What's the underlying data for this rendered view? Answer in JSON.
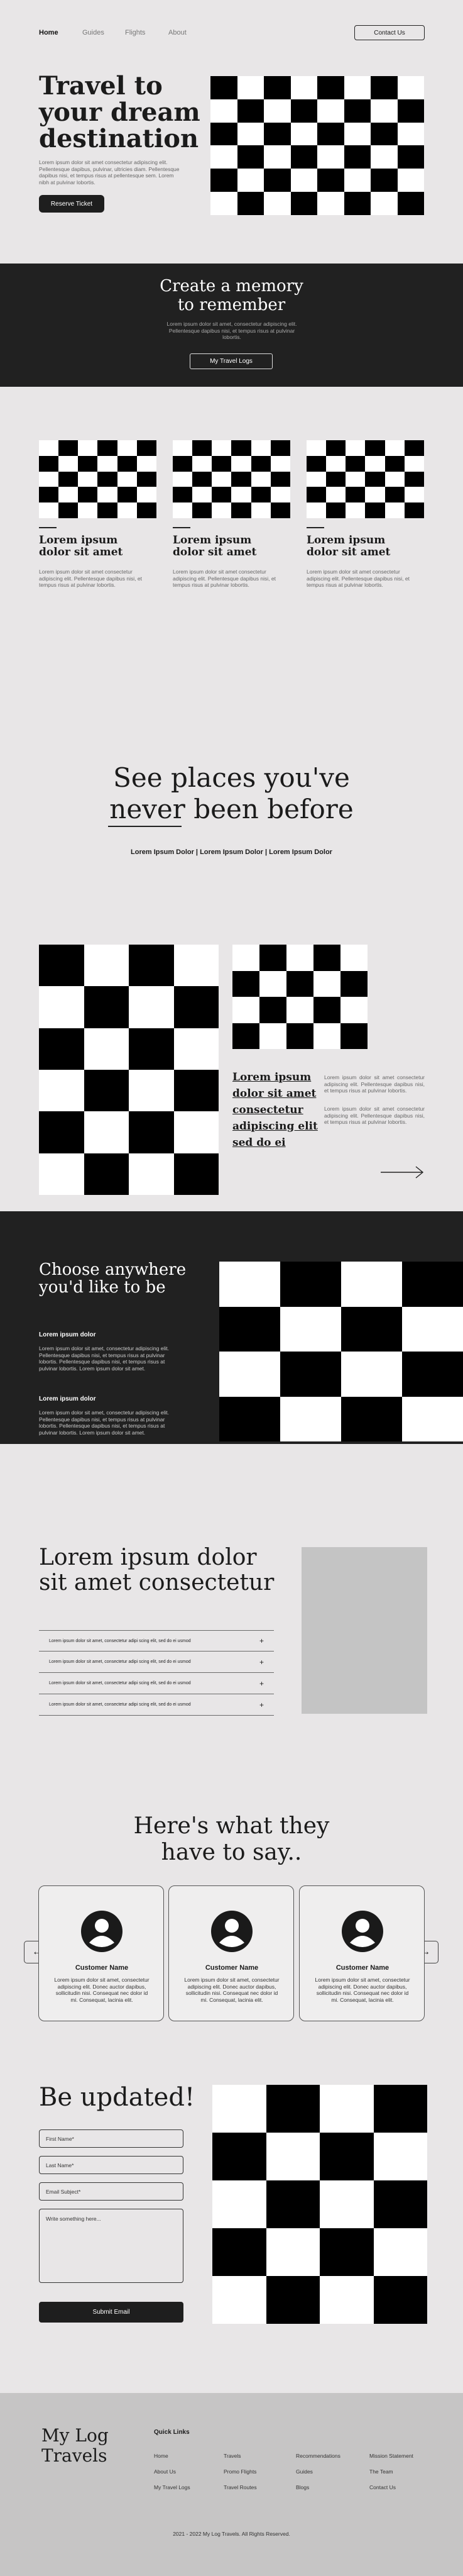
{
  "nav": {
    "home": "Home",
    "guides": "Guides",
    "flights": "Flights",
    "about": "About",
    "contact": "Contact Us"
  },
  "hero": {
    "title_lines": [
      "Travel to",
      "your dream",
      "destination"
    ],
    "body": "Lorem ipsum dolor sit amet consectetur adipiscing elit. Pellentesque dapibus, pulvinar, ultricies diam. Pellentesque dapibus nisi, et tempus risus at pellentesque sem. Lorem nibh at pulvinar lobortis.",
    "button": "Reserve Ticket"
  },
  "memory": {
    "title_lines": [
      "Create a memory",
      "to remember"
    ],
    "body": "Lorem ipsum dolor sit amet, consectetur adipiscing elit. Pellentesque dapibus nisi, et tempus risus at pulvinar lobortis.",
    "button": "My Travel Logs"
  },
  "feature_cards": [
    {
      "title_lines": [
        "Lorem ipsum",
        "dolor sit amet"
      ],
      "body": "Lorem ipsum dolor sit amet consectetur adipiscing elit. Pellentesque dapibus nisi, et tempus risus at pulvinar lobortis."
    },
    {
      "title_lines": [
        "Lorem ipsum",
        "dolor sit amet"
      ],
      "body": "Lorem ipsum dolor sit amet consectetur adipiscing elit. Pellentesque dapibus nisi, et tempus risus at pulvinar lobortis."
    },
    {
      "title_lines": [
        "Lorem ipsum",
        "dolor sit amet"
      ],
      "body": "Lorem ipsum dolor sit amet consectetur adipiscing elit. Pellentesque dapibus nisi, et tempus risus at pulvinar lobortis."
    }
  ],
  "places": {
    "title_lines": [
      "See places you've",
      "never been before"
    ],
    "tags": "Lorem Ipsum Dolor | Lorem Ipsum Dolor | Lorem Ipsum Dolor"
  },
  "gallery": {
    "caption_lines": [
      "Lorem ipsum",
      "dolor sit amet",
      "consectetur",
      "adipiscing elit",
      "sed do ei"
    ],
    "para1": "Lorem ipsum dolor sit amet consectetur adipiscing elit. Pellentesque dapibus nisi, et tempus risus at pulvinar lobortis.",
    "para2": "Lorem ipsum dolor sit amet consectetur adipiscing elit. Pellentesque dapibus nisi, et tempus risus at pulvinar lobortis."
  },
  "choose": {
    "title_lines": [
      "Choose anywhere",
      "you'd like to be"
    ],
    "h1": "Lorem ipsum dolor",
    "p1": "Lorem ipsum dolor sit amet, consectetur adipiscing elit. Pellentesque dapibus nisi, et tempus risus at pulvinar lobortis. Pellentesque dapibus nisi, et tempus risus at pulvinar lobortis. Lorem ipsum dolor sit amet.",
    "h2": "Lorem ipsum dolor",
    "p2": "Lorem ipsum dolor sit amet, consectetur adipiscing elit. Pellentesque dapibus nisi, et tempus risus at pulvinar lobortis. Pellentesque dapibus nisi, et tempus risus at pulvinar lobortis. Lorem ipsum dolor sit amet."
  },
  "faq": {
    "title_lines": [
      "Lorem ipsum dolor",
      "sit amet consectetur"
    ],
    "items": [
      "Lorem ipsum dolor sit amet, consectetur adipi scing elit, sed do ei usmod",
      "Lorem ipsum dolor sit amet, consectetur adipi scing elit, sed do ei usmod",
      "Lorem ipsum dolor sit amet, consectetur adipi scing elit, sed do ei usmod",
      "Lorem ipsum dolor sit amet, consectetur adipi scing elit, sed do ei usmod"
    ],
    "plus": "+"
  },
  "testimonials": {
    "title_lines": [
      "Here's what they",
      "have to say.."
    ],
    "cards": [
      {
        "name": "Customer Name",
        "quote": "Lorem ipsum dolor sit amet, consectetur adipiscing elit. Donec auctor dapibus, sollicitudin nisi. Consequat nec dolor id mi. Consequat, lacinia elit."
      },
      {
        "name": "Customer Name",
        "quote": "Lorem ipsum dolor sit amet, consectetur adipiscing elit. Donec auctor dapibus, sollicitudin nisi. Consequat nec dolor id mi. Consequat, lacinia elit."
      },
      {
        "name": "Customer Name",
        "quote": "Lorem ipsum dolor sit amet, consectetur adipiscing elit. Donec auctor dapibus, sollicitudin nisi. Consequat nec dolor id mi. Consequat, lacinia elit."
      }
    ],
    "prev": "←",
    "next": "→"
  },
  "updated": {
    "title": "Be updated!",
    "first_name": "First Name*",
    "last_name": "Last Name*",
    "email": "Email Subject*",
    "message": "Write something here...",
    "submit": "Submit Email"
  },
  "footer": {
    "brand_lines": [
      "My Log",
      "Travels"
    ],
    "quick_links": "Quick Links",
    "col1": [
      "Home",
      "About Us",
      "My Travel Logs"
    ],
    "col2": [
      "Travels",
      "Promo Flights",
      "Travel Routes"
    ],
    "col3": [
      "Recommendations",
      "Guides",
      "Blogs"
    ],
    "col4": [
      "Mission Statement",
      "The Team",
      "Contact Us"
    ],
    "copyright": "2021 - 2022 My Log Travels. All Rights Reserved."
  }
}
